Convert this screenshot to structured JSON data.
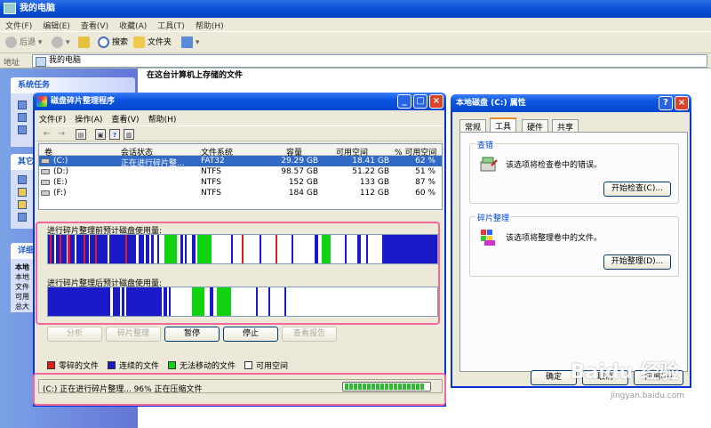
{
  "explorer": {
    "title": "我的电脑",
    "menu": [
      "文件(F)",
      "编辑(E)",
      "查看(V)",
      "收藏(A)",
      "工具(T)",
      "帮助(H)"
    ],
    "toolbar": {
      "back": "后退",
      "search": "搜索",
      "folders": "文件夹"
    },
    "address_label": "地址",
    "address_value": "我的电脑",
    "content_title": "在这台计算机上存储的文件",
    "left": {
      "system_tasks": "系统任务",
      "other_places": "其它",
      "details": "详细",
      "detail_lines": [
        "本地",
        "本地",
        "文件",
        "可用",
        "总大"
      ]
    }
  },
  "colors": {
    "fragmented": "#e21b1b",
    "contiguous": "#1a1ac8",
    "unmovable": "#12d312",
    "free": "#ffffff",
    "highlight": "#f06a9e"
  },
  "defrag": {
    "title": "磁盘碎片整理程序",
    "menu": [
      "文件(F)",
      "操作(A)",
      "查看(V)",
      "帮助(H)"
    ],
    "columns": [
      "卷",
      "会话状态",
      "文件系统",
      "容量",
      "可用空间",
      "% 可用空间"
    ],
    "volumes": [
      {
        "name": "(C:)",
        "status": "正在进行碎片整...",
        "fs": "FAT32",
        "capacity": "29.29 GB",
        "free": "18.41 GB",
        "pct": "62 %"
      },
      {
        "name": "(D:)",
        "status": "",
        "fs": "NTFS",
        "capacity": "98.57 GB",
        "free": "51.22 GB",
        "pct": "51 %"
      },
      {
        "name": "(E:)",
        "status": "",
        "fs": "NTFS",
        "capacity": "152 GB",
        "free": "133 GB",
        "pct": "87 %"
      },
      {
        "name": "(F:)",
        "status": "",
        "fs": "NTFS",
        "capacity": "184 GB",
        "free": "112 GB",
        "pct": "60 %"
      }
    ],
    "before_label": "进行碎片整理前预计磁盘使用量:",
    "after_label": "进行碎片整理后预计磁盘使用量:",
    "buttons": {
      "analyze": "分析",
      "defrag": "碎片整理",
      "pause": "暂停",
      "stop": "停止",
      "report": "查看报告"
    },
    "legend": {
      "fragmented": "零碎的文件",
      "contiguous": "连续的文件",
      "unmovable": "无法移动的文件",
      "free": "可用空间"
    },
    "status": "(C:) 正在进行碎片整理... 96%  正在压缩文件",
    "progress": 0.96
  },
  "props": {
    "title": "本地磁盘 (C:) 属性",
    "tabs": [
      "常规",
      "工具",
      "硬件",
      "共享"
    ],
    "active_tab": 1,
    "check": {
      "title": "查错",
      "desc": "该选项将检查卷中的错误。",
      "button": "开始检查(C)..."
    },
    "defrag": {
      "title": "碎片整理",
      "desc": "该选项将整理卷中的文件。",
      "button": "开始整理(D)..."
    },
    "bottom_buttons": [
      "确定",
      "取消",
      "应用(A)"
    ]
  },
  "watermark": {
    "text": "Baidu 经验",
    "url": "jingyan.baidu.com"
  }
}
